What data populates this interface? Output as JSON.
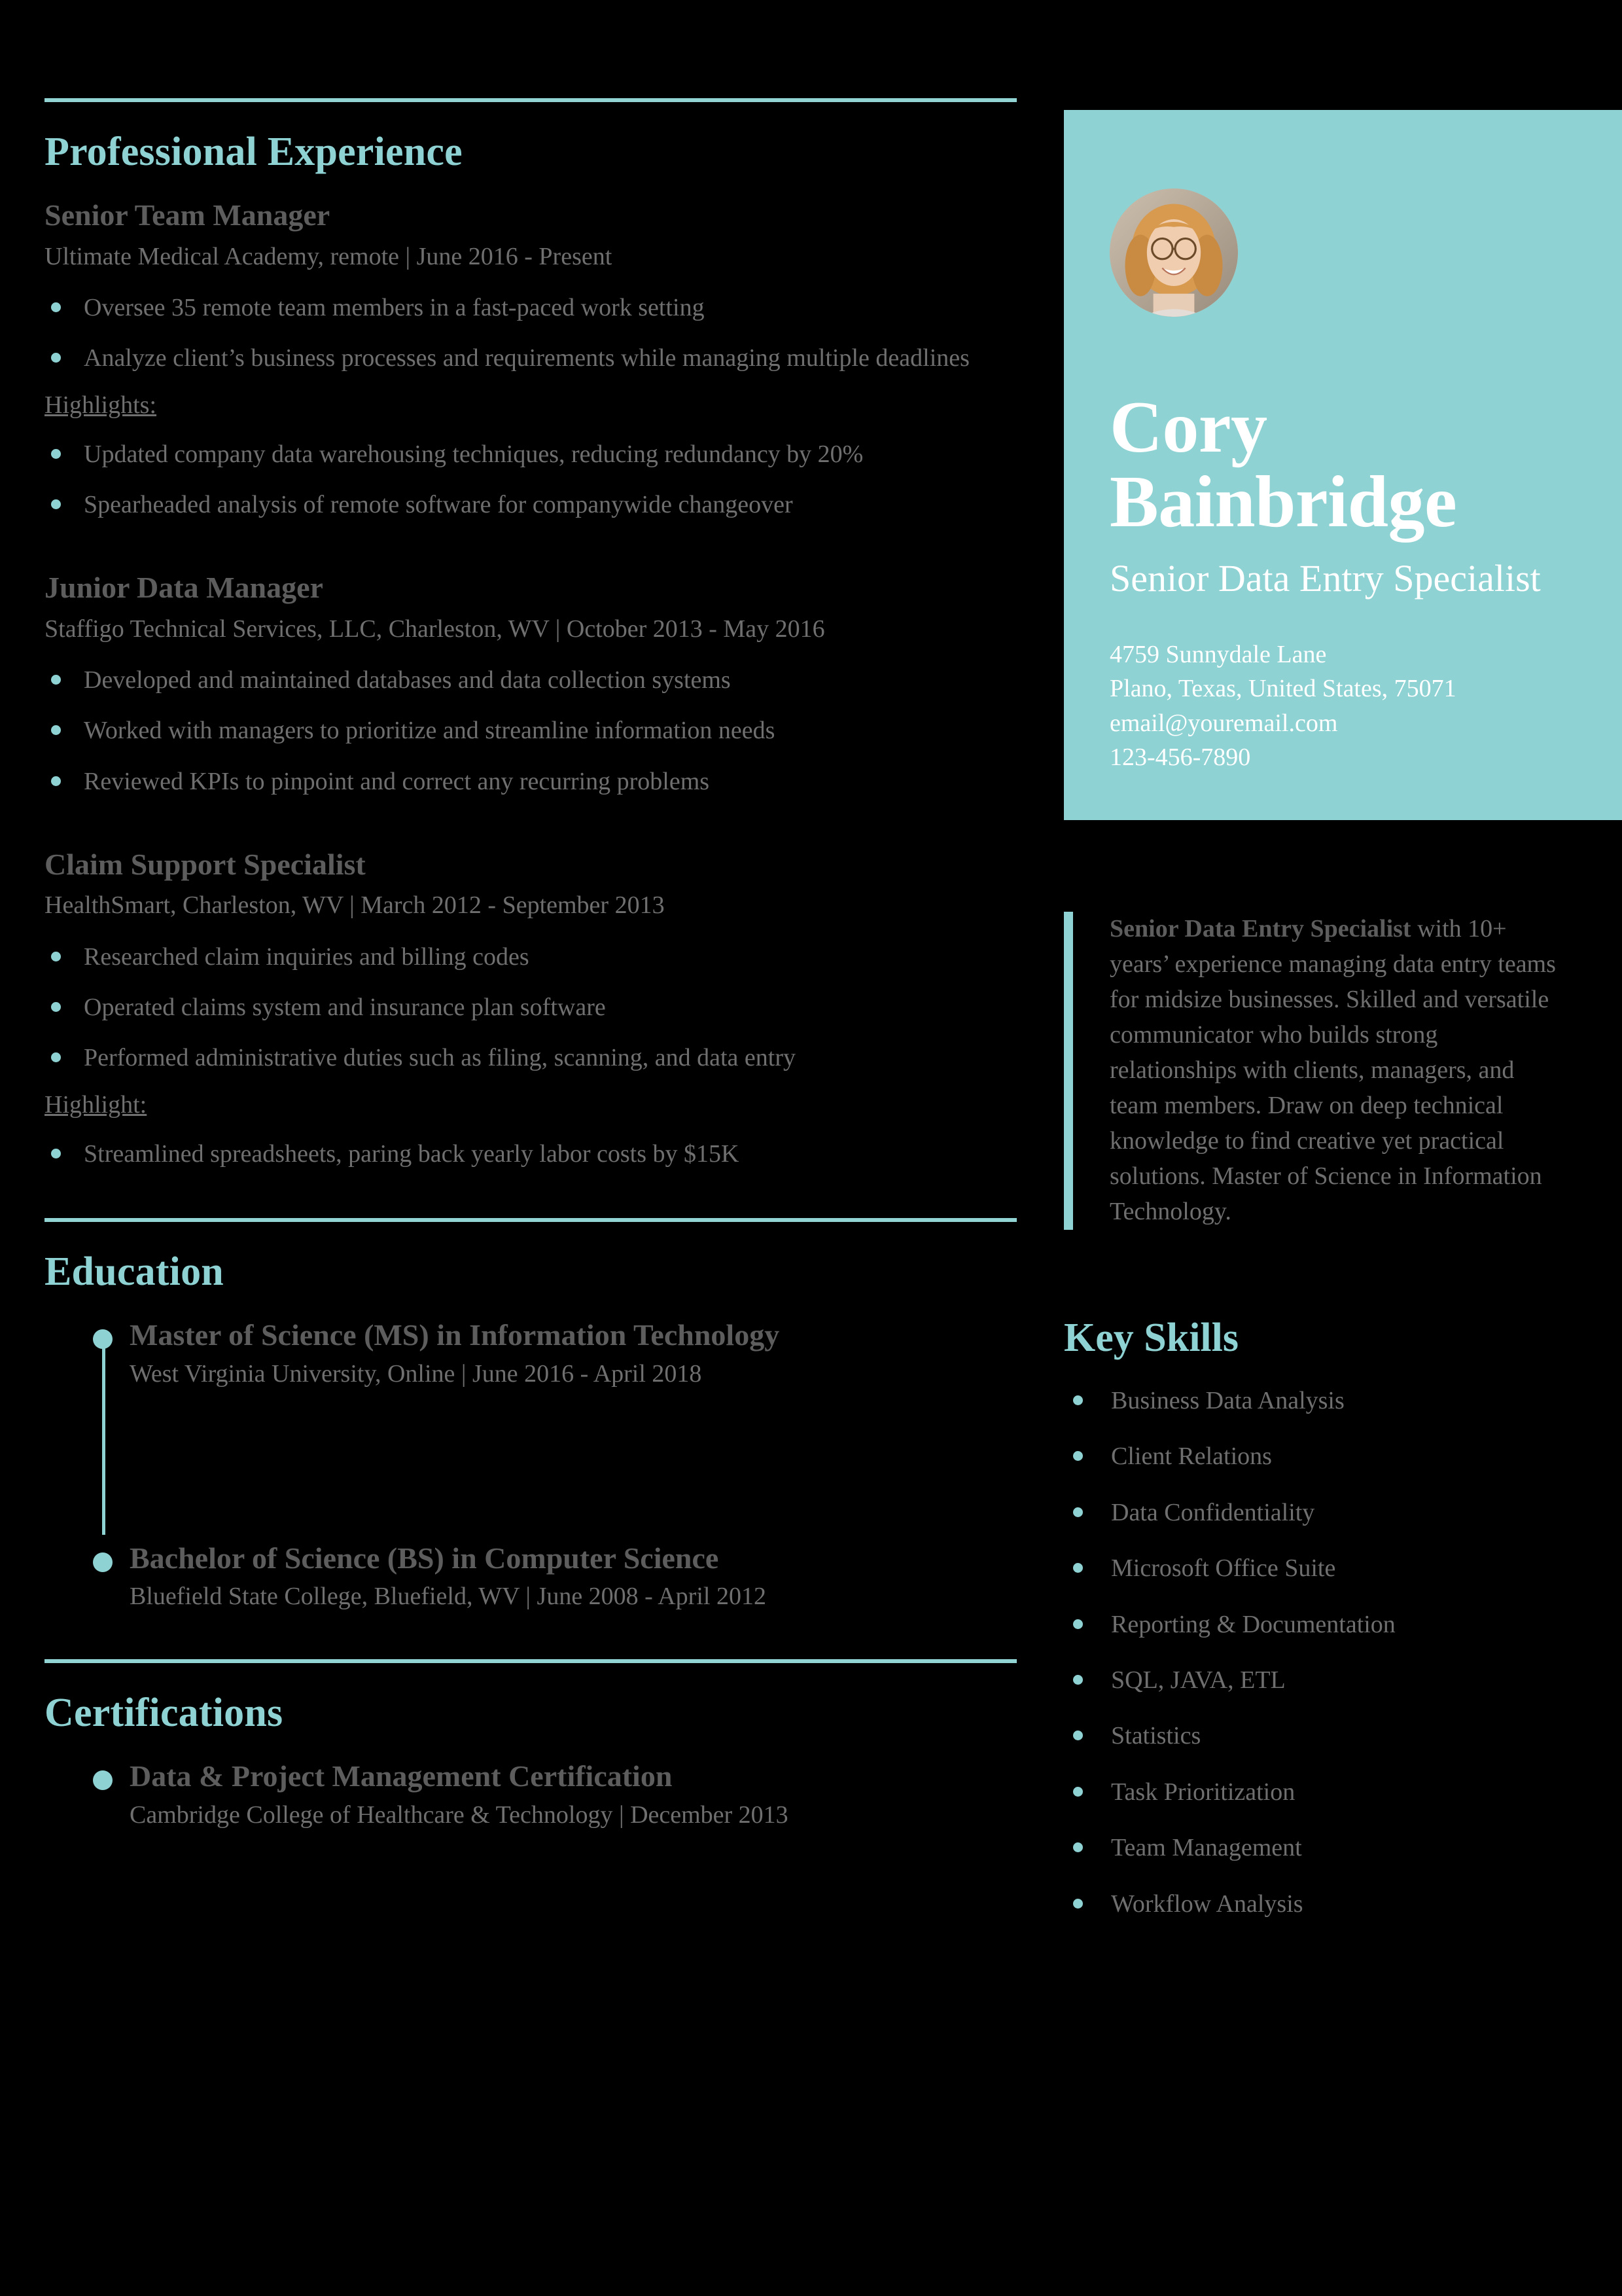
{
  "theme": {
    "accent": "#8fd2d3",
    "heading_color": "#8fd2d3",
    "body_text": "#6f6f6f",
    "strong_text": "#5d5d5d",
    "page_bg": "#000000",
    "card_text": "#ffffff"
  },
  "profile": {
    "name": "Cory Bainbridge",
    "role": "Senior Data Entry Specialist",
    "address_line1": "4759 Sunnydale Lane",
    "address_line2": "Plano, Texas, United States, 75071",
    "email": "email@youremail.com",
    "phone": "123-456-7890"
  },
  "summary": {
    "lead": "Senior Data Entry Specialist",
    "rest": " with 10+ years’ experience managing data entry teams for midsize businesses. Skilled and versatile communicator who builds strong relationships with clients, managers, and team members. Draw on deep technical knowledge to find creative yet practical solutions. Master of Science in Information Technology."
  },
  "sections": {
    "experience_title": "Professional Experience",
    "education_title": "Education",
    "certifications_title": "Certifications",
    "skills_title": "Key Skills"
  },
  "experience": [
    {
      "title": "Senior Team Manager",
      "meta": "Ultimate Medical Academy, remote | June 2016 - Present",
      "bullets": [
        "Oversee 35 remote team members in a fast-paced work setting",
        "Analyze client’s business processes and requirements while managing multiple deadlines"
      ],
      "highlight_label": "Highlights:",
      "highlights": [
        "Updated company data warehousing techniques, reducing redundancy by 20%",
        "Spearheaded analysis of remote software for companywide changeover"
      ]
    },
    {
      "title": "Junior Data Manager",
      "meta": "Staffigo Technical Services, LLC, Charleston, WV | October 2013 - May 2016",
      "bullets": [
        "Developed and maintained databases and data collection systems",
        "Worked with managers to prioritize and streamline information needs",
        "Reviewed KPIs to pinpoint and correct any recurring problems"
      ],
      "highlight_label": "",
      "highlights": []
    },
    {
      "title": "Claim Support Specialist",
      "meta": "HealthSmart, Charleston, WV | March 2012 - September 2013",
      "bullets": [
        "Researched claim inquiries and billing codes",
        "Operated claims system and insurance plan software",
        "Performed administrative duties such as filing, scanning, and data entry"
      ],
      "highlight_label": "Highlight:",
      "highlights": [
        "Streamlined spreadsheets, paring back yearly labor costs by $15K"
      ]
    }
  ],
  "education": [
    {
      "degree": "Master of Science (MS) in Information Technology",
      "meta": "West Virginia University, Online | June 2016 - April 2018"
    },
    {
      "degree": "Bachelor of Science (BS) in Computer Science",
      "meta": "Bluefield State College, Bluefield, WV | June 2008 - April 2012"
    }
  ],
  "certifications": [
    {
      "name": "Data & Project Management Certification",
      "meta": "Cambridge College of Healthcare & Technology | December 2013"
    }
  ],
  "skills": [
    "Business Data Analysis",
    "Client Relations",
    "Data Confidentiality",
    "Microsoft Office Suite",
    "Reporting & Documentation",
    "SQL, JAVA, ETL",
    "Statistics",
    "Task Prioritization",
    "Team Management",
    "Workflow Analysis"
  ]
}
